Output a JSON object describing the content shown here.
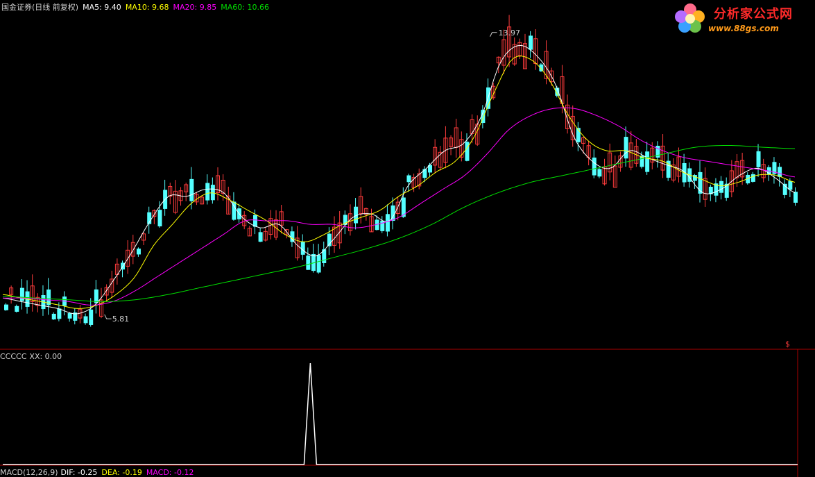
{
  "header": {
    "title": "国金证券(日线 前复权)",
    "ma5": "MA5: 9.40",
    "ma10": "MA10: 9.68",
    "ma20": "MA20: 9.85",
    "ma60": "MA60: 10.66"
  },
  "annotations": {
    "high": "13.97",
    "low": "5.81"
  },
  "indicator": {
    "name": "CCCCC",
    "value": "XX: 0.00"
  },
  "macd": {
    "label": "MACD(12,26,9)",
    "dif": "DIF: -0.25",
    "dea": "DEA: -0.19",
    "macd": "MACD: -0.12"
  },
  "marker": "$",
  "logo": {
    "name": "分析家公式网",
    "url": "www.88gs.com"
  },
  "colors": {
    "background": "#000000",
    "up_candle": "#ff3c3c",
    "down_candle": "#54ffff",
    "ma5": "#ffffff",
    "ma10": "#ffff00",
    "ma20": "#ff00ff",
    "ma60": "#00e000",
    "divider": "#aa0000"
  },
  "chart_data": [
    {
      "type": "candlestick",
      "title": "国金证券(日线 前复权)",
      "series": [
        {
          "name": "MA5",
          "values": [
            6.4,
            6.3,
            6.2,
            6.1,
            5.95,
            6.2,
            6.9,
            7.7,
            8.6,
            9.3,
            9.3,
            9.5,
            9.4,
            8.7,
            8.4,
            8.5,
            7.9,
            7.6,
            8.1,
            8.7,
            8.8,
            8.6,
            9.6,
            10.1,
            10.6,
            10.8,
            11.6,
            13.1,
            13.6,
            13.3,
            12.5,
            11.0,
            10.3,
            10.1,
            10.6,
            10.4,
            10.2,
            10.0,
            9.4,
            9.5,
            9.9,
            10.1,
            9.8,
            9.4
          ]
        },
        {
          "name": "MA10",
          "values": [
            6.5,
            6.4,
            6.3,
            6.2,
            6.1,
            6.2,
            6.5,
            7.0,
            7.9,
            8.5,
            9.1,
            9.4,
            9.2,
            8.9,
            8.6,
            8.2,
            8.0,
            8.2,
            8.5,
            8.7,
            8.9,
            9.3,
            9.6,
            10.0,
            10.3,
            11.0,
            12.2,
            13.2,
            13.2,
            12.6,
            11.6,
            10.9,
            10.6,
            10.6,
            10.4,
            10.3,
            10.0,
            9.8,
            9.6,
            9.7,
            9.9,
            9.9,
            9.7
          ]
        },
        {
          "name": "MA20",
          "values": [
            6.4,
            6.4,
            6.35,
            6.3,
            6.2,
            6.3,
            6.6,
            7.0,
            7.4,
            7.8,
            8.2,
            8.6,
            8.6,
            8.6,
            8.5,
            8.5,
            8.4,
            8.5,
            8.7,
            9.1,
            9.5,
            9.9,
            10.5,
            11.2,
            11.6,
            11.8,
            11.8,
            11.6,
            11.3,
            10.9,
            10.6,
            10.4,
            10.3,
            10.2,
            10.1,
            10.0,
            9.85
          ]
        },
        {
          "name": "MA60",
          "values": [
            6.45,
            6.4,
            6.35,
            6.3,
            6.35,
            6.5,
            6.7,
            6.9,
            7.1,
            7.3,
            7.55,
            7.8,
            8.1,
            8.5,
            9.0,
            9.4,
            9.7,
            9.9,
            10.1,
            10.3,
            10.5,
            10.7,
            10.75,
            10.7,
            10.66
          ]
        }
      ],
      "annotations": [
        {
          "label": "13.97",
          "value": 13.97
        },
        {
          "label": "5.81",
          "value": 5.81
        }
      ],
      "ylim": [
        5.0,
        14.5
      ]
    },
    {
      "type": "line",
      "title": "CCCCC",
      "series": [
        {
          "name": "XX",
          "values": [
            0,
            0,
            0,
            0,
            0,
            0,
            0,
            0,
            0,
            0,
            0,
            0,
            0,
            0,
            0,
            0,
            0,
            0,
            0,
            0,
            0,
            0,
            0,
            0,
            0,
            0,
            1,
            0,
            0,
            0,
            0,
            0,
            0,
            0,
            0,
            0,
            0,
            0,
            0,
            0,
            0,
            0,
            0,
            0,
            0,
            0,
            0,
            0,
            0,
            0,
            0,
            0,
            0,
            0,
            0,
            0,
            0,
            0,
            0,
            0,
            0,
            0,
            0,
            0,
            0,
            0,
            0,
            0,
            0,
            0,
            0,
            0,
            0,
            0,
            0,
            0,
            0,
            0,
            0,
            0
          ]
        }
      ],
      "ylim": [
        0,
        1
      ]
    }
  ]
}
